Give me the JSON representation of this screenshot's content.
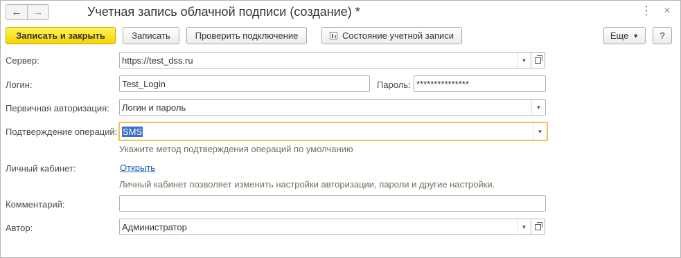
{
  "window": {
    "title": "Учетная запись облачной подписи (создание) *",
    "back_icon": "←",
    "forward_icon": "→",
    "menu_icon": "⋮",
    "close_icon": "×"
  },
  "toolbar": {
    "save_close": "Записать и закрыть",
    "save": "Записать",
    "check_connection": "Проверить подключение",
    "account_state": "Состояние учетной записи",
    "more": "Еще",
    "help": "?"
  },
  "form": {
    "server": {
      "label": "Сервер:",
      "value": "https://test_dss.ru"
    },
    "login": {
      "label": "Логин:",
      "value": "Test_Login"
    },
    "password": {
      "label": "Пароль:",
      "value": "***************"
    },
    "primary_auth": {
      "label": "Первичная авторизация:",
      "value": "Логин и пароль"
    },
    "confirm_ops": {
      "label": "Подтверждение операций:",
      "value": "SMS",
      "hint": "Укажите метод подтверждения операций по умолчанию"
    },
    "cabinet": {
      "label": "Личный кабинет:",
      "link": "Открыть",
      "hint": "Личный кабинет позволяет изменить настройки авторизации, пароли и другие настройки."
    },
    "comment": {
      "label": "Комментарий:",
      "value": ""
    },
    "author": {
      "label": "Автор:",
      "value": "Администратор"
    }
  },
  "colors": {
    "primary_button": "#f5d400",
    "focus_border": "#f0c24b",
    "link": "#1a56b0",
    "selection": "#3d6fc6"
  }
}
